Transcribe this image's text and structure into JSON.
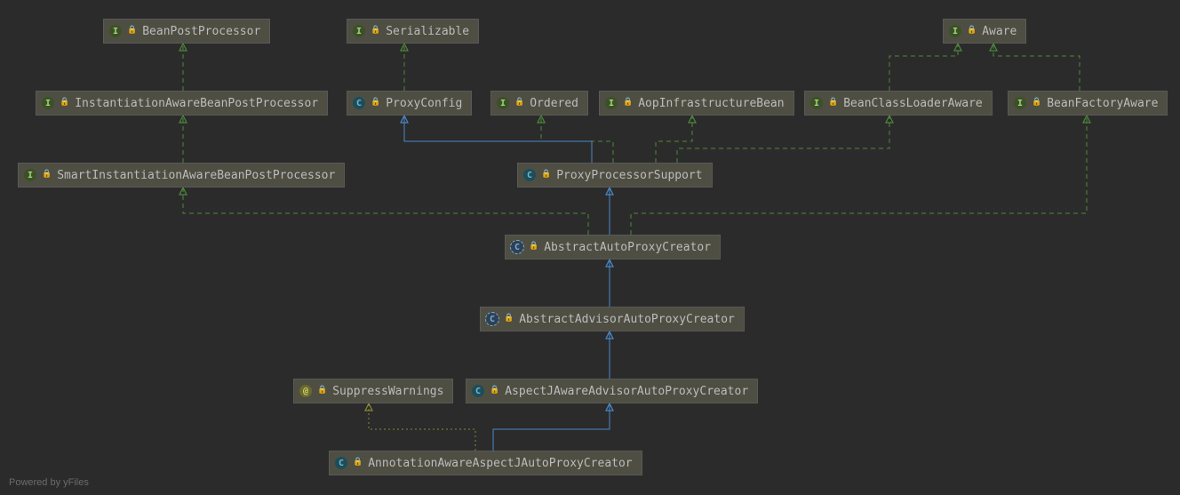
{
  "footer": "Powered by yFiles",
  "nodes": {
    "beanPostProcessor": {
      "label": "BeanPostProcessor",
      "kind": "interface"
    },
    "serializable": {
      "label": "Serializable",
      "kind": "interface"
    },
    "aware": {
      "label": "Aware",
      "kind": "interface"
    },
    "instBeanPP": {
      "label": "InstantiationAwareBeanPostProcessor",
      "kind": "interface"
    },
    "proxyConfig": {
      "label": "ProxyConfig",
      "kind": "class"
    },
    "ordered": {
      "label": "Ordered",
      "kind": "interface"
    },
    "aopInfraBean": {
      "label": "AopInfrastructureBean",
      "kind": "interface"
    },
    "beanClassLoaderAware": {
      "label": "BeanClassLoaderAware",
      "kind": "interface"
    },
    "beanFactoryAware": {
      "label": "BeanFactoryAware",
      "kind": "interface"
    },
    "smartInstBeanPP": {
      "label": "SmartInstantiationAwareBeanPostProcessor",
      "kind": "interface"
    },
    "proxyProcSupport": {
      "label": "ProxyProcessorSupport",
      "kind": "class"
    },
    "absAutoProxyCreator": {
      "label": "AbstractAutoProxyCreator",
      "kind": "abstract"
    },
    "absAdvAutoProxyCreator": {
      "label": "AbstractAdvisorAutoProxyCreator",
      "kind": "abstract"
    },
    "suppressWarnings": {
      "label": "SuppressWarnings",
      "kind": "annotation"
    },
    "aspectJAware": {
      "label": "AspectJAwareAdvisorAutoProxyCreator",
      "kind": "class"
    },
    "annotAware": {
      "label": "AnnotationAwareAspectJAutoProxyCreator",
      "kind": "class"
    }
  },
  "edges": [
    {
      "from": "instBeanPP",
      "to": "beanPostProcessor",
      "style": "implements"
    },
    {
      "from": "proxyConfig",
      "to": "serializable",
      "style": "implements"
    },
    {
      "from": "beanClassLoaderAware",
      "to": "aware",
      "style": "implements"
    },
    {
      "from": "beanFactoryAware",
      "to": "aware",
      "style": "implements"
    },
    {
      "from": "smartInstBeanPP",
      "to": "instBeanPP",
      "style": "implements"
    },
    {
      "from": "proxyProcSupport",
      "to": "proxyConfig",
      "style": "extends"
    },
    {
      "from": "proxyProcSupport",
      "to": "ordered",
      "style": "implements"
    },
    {
      "from": "proxyProcSupport",
      "to": "aopInfraBean",
      "style": "implements"
    },
    {
      "from": "proxyProcSupport",
      "to": "beanClassLoaderAware",
      "style": "implements"
    },
    {
      "from": "absAutoProxyCreator",
      "to": "proxyProcSupport",
      "style": "extends"
    },
    {
      "from": "absAutoProxyCreator",
      "to": "smartInstBeanPP",
      "style": "implements"
    },
    {
      "from": "absAutoProxyCreator",
      "to": "beanFactoryAware",
      "style": "implements"
    },
    {
      "from": "absAdvAutoProxyCreator",
      "to": "absAutoProxyCreator",
      "style": "extends"
    },
    {
      "from": "aspectJAware",
      "to": "absAdvAutoProxyCreator",
      "style": "extends"
    },
    {
      "from": "annotAware",
      "to": "aspectJAware",
      "style": "extends"
    },
    {
      "from": "annotAware",
      "to": "suppressWarnings",
      "style": "annotation"
    }
  ]
}
